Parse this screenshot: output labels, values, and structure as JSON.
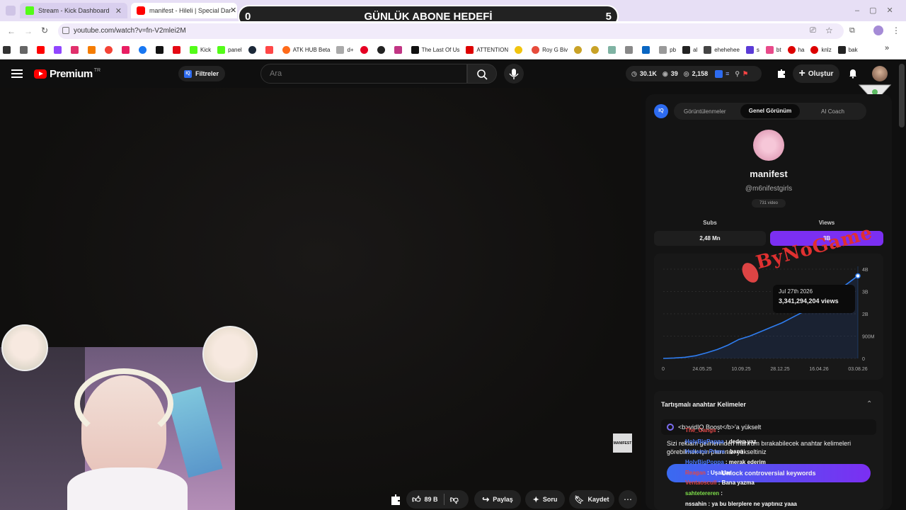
{
  "browser": {
    "tabs": [
      {
        "title": "Stream - Kick Dashboard"
      },
      {
        "title": "manifest - Hileli | Special Danc"
      }
    ],
    "url": "youtube.com/watch?v=fn-V2mlei2M",
    "bookmarks": [
      "Kick",
      "panel",
      "ATK HUB Beta",
      "d+",
      "The Last Of Us",
      "ATTENTION",
      "Roy G Biv",
      "pb",
      "al",
      "ehehehee",
      "s",
      "bt",
      "ha",
      "knlz",
      "bak"
    ]
  },
  "overlay": {
    "goal_title": "GÜNLÜK ABONE HEDEFİ",
    "goal_current": "0",
    "goal_target": "5",
    "watermark": "ByNoGame"
  },
  "youtube": {
    "logo_text": "Premium",
    "logo_region": "TR",
    "filters_label": "Filtreler",
    "search_placeholder": "Ara",
    "stats": {
      "subs": "30.1K",
      "watching": "39",
      "views": "2,158"
    },
    "create_label": "Oluştur",
    "actions": {
      "likes": "89 B",
      "share": "Paylaş",
      "ask": "Soru",
      "save": "Kaydet"
    },
    "video_brand": "MANIFEST"
  },
  "panel": {
    "tabs": [
      "Görüntülenmeler",
      "Genel Görünüm",
      "AI Coach"
    ],
    "channel_name": "manifest",
    "handle": "@m6nifestgirls",
    "video_count": "731 video",
    "subs_label": "Subs",
    "views_label": "Views",
    "subs_value": "2,48 Mn",
    "views_value": "3B",
    "tooltip_date": "Jul 27th 2026",
    "tooltip_value": "3,341,294,204 views",
    "keywords_title": "Tartışmalı anahtar Kelimeler",
    "boost_text": "<b>vidIQ Boost</b>'a yükselt",
    "desc_text": "Sizi reklam gelirlerinden mahrum bırakabilecek anahtar kelimeleri görebilmek için planınızı yükseltiniz",
    "unlock_label": "Unlock controversial keywords"
  },
  "chat": [
    {
      "user": "The_Gangs",
      "msg": "",
      "color": "#e04848"
    },
    {
      "user": "HolyBigPoppa",
      "msg": "deden yaz",
      "color": "#4a7bff"
    },
    {
      "user": "Hokamo Prens",
      "msg": "bana",
      "color": "#4a7bff"
    },
    {
      "user": "HolyBigPoppa",
      "msg": "merak ederim",
      "color": "#4a7bff"
    },
    {
      "user": "Reagan",
      "msg": "Uşaklar",
      "color": "#e04848"
    },
    {
      "user": "Ventaoscull",
      "msg": "Bana yazma",
      "color": "#e04848"
    },
    {
      "user": "sahtetereren",
      "msg": "",
      "color": "#7ee04a"
    },
    {
      "user": "nssahin",
      "msg": "ya bu blerplere ne yaptınız yaaa",
      "color": "#ffffff"
    }
  ],
  "chart_data": {
    "type": "area",
    "x_ticks": [
      "0",
      "24.05.25",
      "10.09.25",
      "28.12.25",
      "16.04.26",
      "03.08.26"
    ],
    "y_ticks": [
      "0",
      "900M",
      "2B",
      "3B",
      "4B"
    ],
    "series": [
      {
        "values": [
          0,
          0.02,
          0.05,
          0.12,
          0.25,
          0.4,
          0.6,
          0.85,
          1.0,
          1.2,
          1.4,
          1.6,
          1.85,
          2.1,
          2.4,
          2.7,
          3.0,
          3.34,
          3.7
        ]
      }
    ],
    "ylim": [
      0,
      4
    ]
  }
}
